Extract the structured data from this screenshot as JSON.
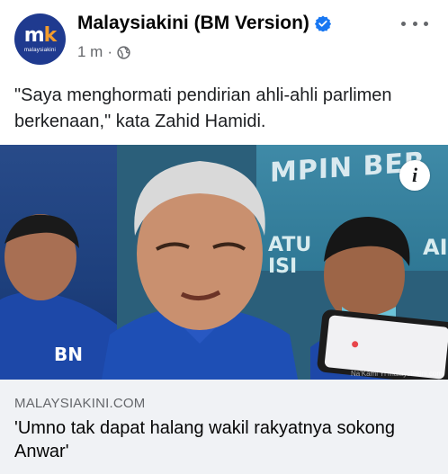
{
  "header": {
    "page_name": "Malaysiakini (BM Version)",
    "timestamp": "1 m",
    "separator": "·",
    "avatar": {
      "mark_m": "m",
      "mark_k": "k",
      "wordmark": "malaysiakini"
    },
    "icons": {
      "verified": "verified-badge-icon",
      "audience": "globe-icon",
      "more": "more-options-icon"
    },
    "colors": {
      "verified": "#1877f2",
      "avatar_bg": "#1f3a8f",
      "meta_text": "#65676b"
    }
  },
  "post": {
    "text": "\"Saya menghormati pendirian ahli-ahli parlimen berkenaan,\" kata Zahid Hamidi."
  },
  "image": {
    "banner_text": "MPIN BER",
    "banner_side": "ATU\nISI",
    "banner_right": "AI",
    "badge_text": "BN",
    "info_icon": "i",
    "watermark": "Na'Kami Yi malaysiakini.com"
  },
  "link_preview": {
    "domain": "MALAYSIAKINI.COM",
    "title": "'Umno tak dapat halang wakil rakyatnya sokong Anwar'",
    "bg_color": "#f0f2f5"
  }
}
